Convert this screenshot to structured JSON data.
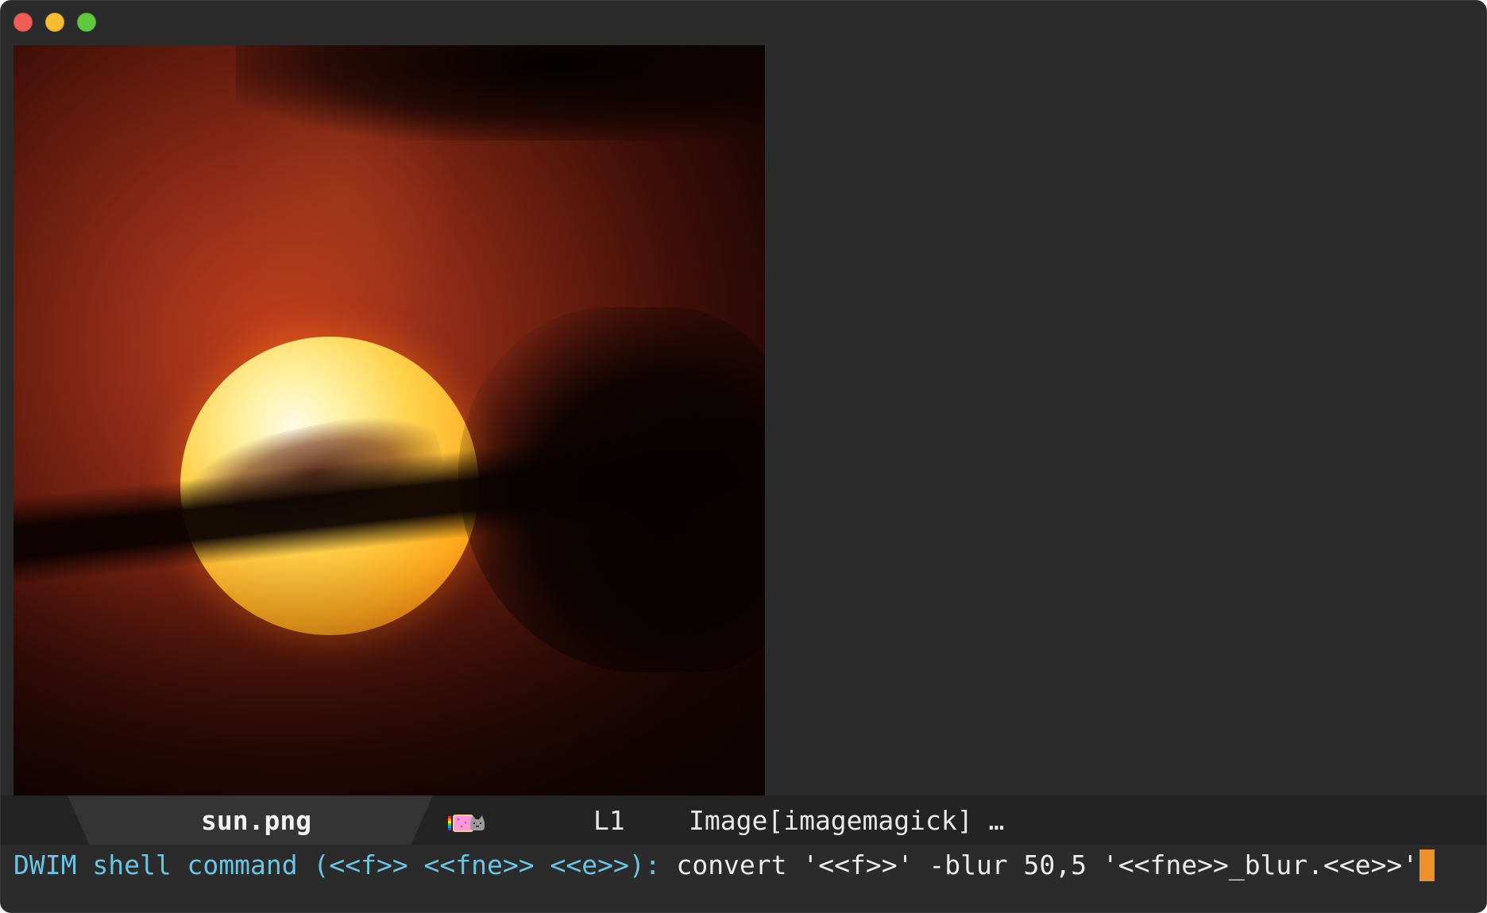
{
  "window": {
    "controls": {
      "close": "close-window",
      "minimize": "minimize-window",
      "maximize": "zoom-window"
    }
  },
  "image_view": {
    "subject": "sunset-photo"
  },
  "modeline": {
    "buffer_name": "sun.png",
    "line": "L1",
    "mode": "Image[imagemagick] …",
    "indicator_icon": "nyan-cat-icon"
  },
  "minibuffer": {
    "prompt": "DWIM shell command (<<f>> <<fne>> <<e>>): ",
    "input": "convert '<<f>>' -blur 50,5 '<<fne>>_blur.<<e>>'"
  },
  "colors": {
    "background": "#2b2b2b",
    "modeline_bg": "#232323",
    "modeline_tab": "#343434",
    "prompt": "#69c5e3",
    "cursor": "#f0902c"
  }
}
